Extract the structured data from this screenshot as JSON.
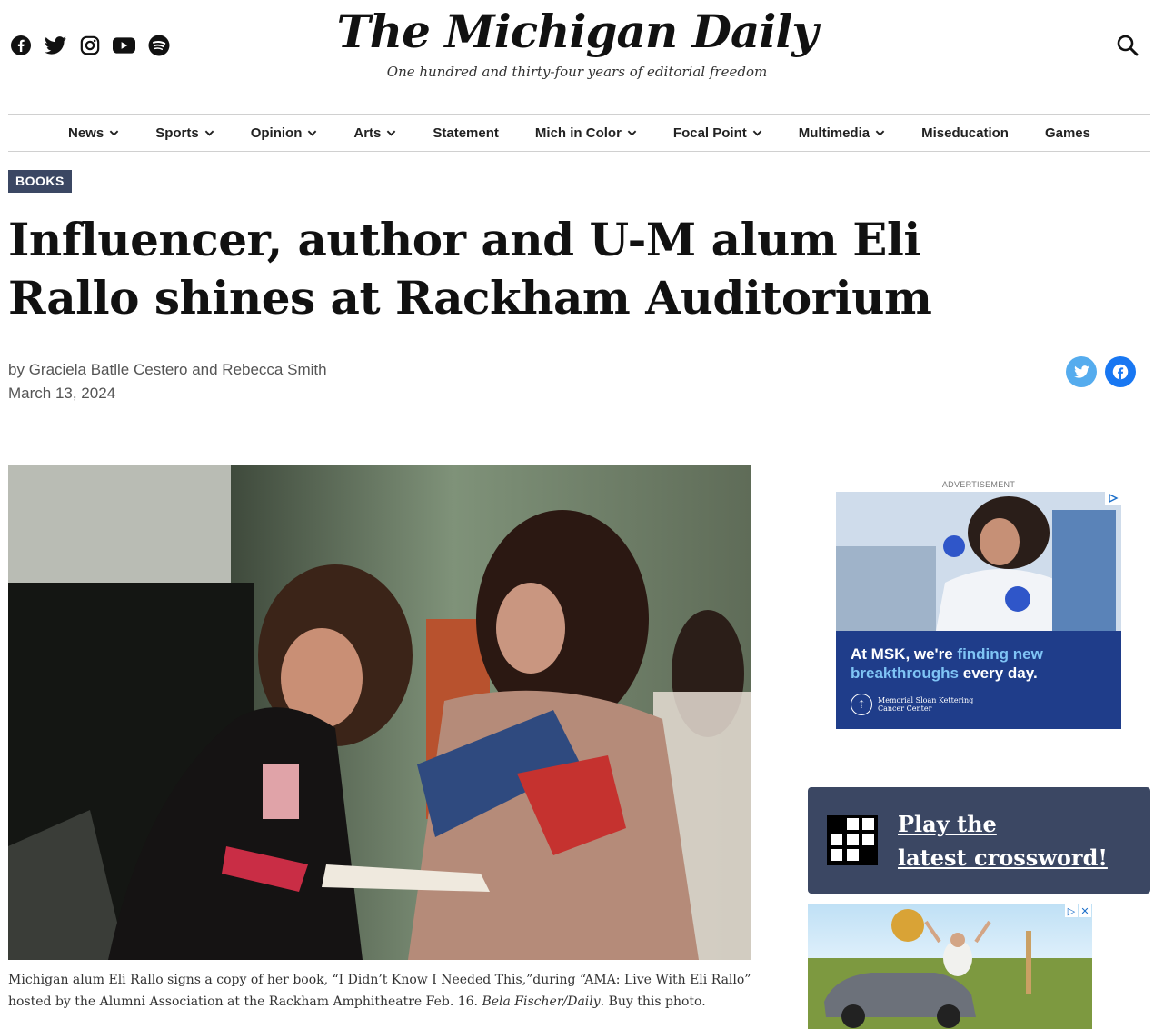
{
  "header": {
    "title": "The Michigan Daily",
    "tagline": "One hundred and thirty-four years of editorial freedom",
    "social_icons": [
      "facebook-icon",
      "twitter-icon",
      "instagram-icon",
      "youtube-icon",
      "spotify-icon"
    ]
  },
  "nav": {
    "items": [
      {
        "label": "News",
        "dropdown": true
      },
      {
        "label": "Sports",
        "dropdown": true
      },
      {
        "label": "Opinion",
        "dropdown": true
      },
      {
        "label": "Arts",
        "dropdown": true
      },
      {
        "label": "Statement",
        "dropdown": false
      },
      {
        "label": "Mich in Color",
        "dropdown": true
      },
      {
        "label": "Focal Point",
        "dropdown": true
      },
      {
        "label": "Multimedia",
        "dropdown": true
      },
      {
        "label": "Miseducation",
        "dropdown": false
      },
      {
        "label": "Games",
        "dropdown": false
      }
    ]
  },
  "article": {
    "category": "BOOKS",
    "headline": "Influencer, author and U-M alum Eli Rallo shines at Rackham Auditorium",
    "byline_prefix": "by ",
    "authors": "Graciela Batlle Cestero and Rebecca Smith",
    "date": "March 13, 2024",
    "caption_text": "Michigan alum Eli Rallo signs a copy of her book, “I Didn’t Know I Needed This,”during “AMA: Live With Eli Rallo” hosted by the Alumni Association at the Rackham Amphitheatre Feb. 16. ",
    "caption_credit": "Bela Fischer/Daily",
    "caption_buy": ". Buy this photo."
  },
  "sidebar": {
    "ad_label": "ADVERTISEMENT",
    "ad1": {
      "text_a": "At MSK, we're ",
      "text_highlight": "finding new breakthroughs",
      "text_b": " every day.",
      "logo_line1": "Memorial Sloan Kettering",
      "logo_line2": "Cancer Center"
    },
    "crossword": {
      "line1": "Play the",
      "line2": "latest crossword!"
    }
  },
  "colors": {
    "accent": "#3b4763",
    "twitter": "#55acee",
    "facebook": "#1877f2",
    "ad_blue": "#1f3d8a"
  }
}
